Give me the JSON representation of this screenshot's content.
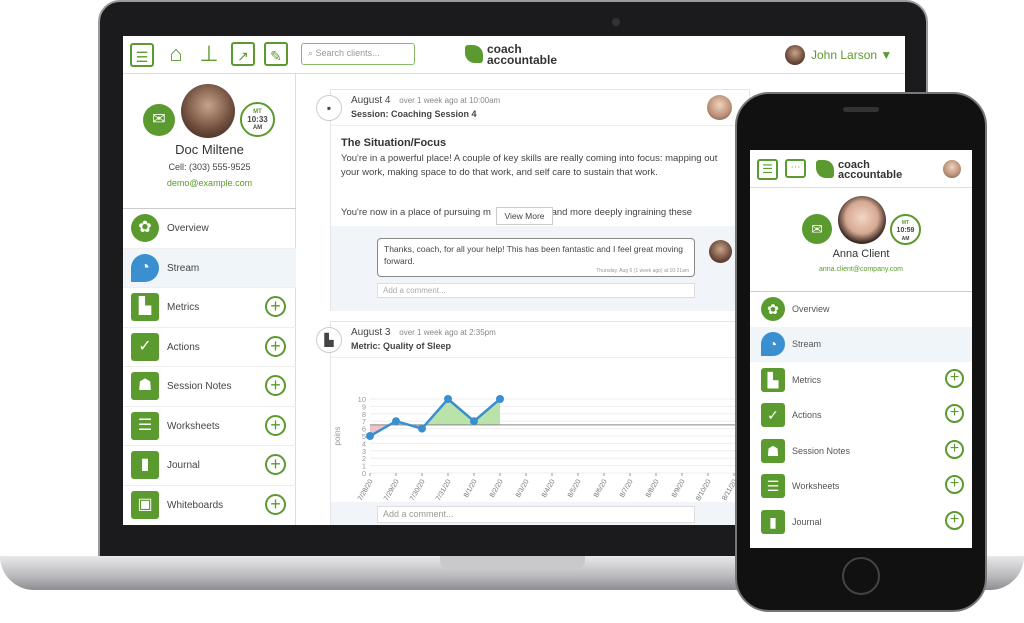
{
  "colors": {
    "brand": "#5b9a2e",
    "series": "#3a8fd0",
    "above": "#b9e3a8",
    "below": "#f2c3c6"
  },
  "laptop": {
    "header": {
      "icons": [
        "menu-icon",
        "home-icon",
        "org-chart-icon",
        "clipboard-chart-icon",
        "worksheet-icon"
      ],
      "search_placeholder": "Search clients...",
      "logo_line1": "coach",
      "logo_line2": "accountable",
      "user_name": "John Larson ▼"
    },
    "profile": {
      "name": "Doc Miltene",
      "cell": "Cell: (303) 555-9525",
      "email": "demo@example.com",
      "clock_tz": "MT",
      "clock_time": "10:33",
      "clock_ampm": "AM"
    },
    "nav": [
      {
        "label": "Overview"
      },
      {
        "label": "Stream"
      },
      {
        "label": "Metrics"
      },
      {
        "label": "Actions"
      },
      {
        "label": "Session Notes"
      },
      {
        "label": "Worksheets"
      },
      {
        "label": "Journal"
      },
      {
        "label": "Whiteboards"
      }
    ],
    "feed": [
      {
        "date": "August 4",
        "ago": "over 1 week ago at 10:00am",
        "title": "Session: Coaching Session 4",
        "heading": "The Situation/Focus",
        "p1": "You're in a powerful place!  A couple of key skills are really coming into focus: mapping out your work, making space to do that work, and self care to sustain that work.",
        "p2": "You're now in a place of pursuing m                    g and more deeply ingraining these",
        "view_more": "View More",
        "comment": "Thanks, coach, for all your help!  This has been fantastic and I feel great moving forward.",
        "comment_time": "Thursday, Aug 6 (1 week ago) at 10:21am",
        "add_comment": "Add a comment..."
      },
      {
        "date": "August 3",
        "ago": "over 1 week ago at 2:35pm",
        "title": "Metric: Quality of Sleep",
        "add_comment": "Add a comment..."
      }
    ]
  },
  "chart_data": {
    "type": "line",
    "ylabel": "poins",
    "ylim": [
      0,
      10
    ],
    "yticks": [
      0,
      1,
      2,
      3,
      4,
      5,
      6,
      7,
      8,
      9,
      10
    ],
    "target": 6.5,
    "categories": [
      "7/28/20",
      "7/29/20",
      "7/30/20",
      "7/31/20",
      "8/1/20",
      "8/2/20",
      "8/3/20",
      "8/4/20",
      "8/5/20",
      "8/6/20",
      "8/7/20",
      "8/8/20",
      "8/9/20",
      "8/10/20",
      "8/11/20"
    ],
    "values": [
      5,
      7,
      6,
      10,
      7,
      10,
      null,
      null,
      null,
      null,
      null,
      null,
      null,
      null,
      null
    ],
    "grid": true
  },
  "phone": {
    "header": {
      "logo_line1": "coach",
      "logo_line2": "accountable"
    },
    "profile": {
      "name": "Anna Client",
      "email": "anna.client@company.com",
      "clock_tz": "MT",
      "clock_time": "10:59",
      "clock_ampm": "AM"
    },
    "nav": [
      {
        "label": "Overview"
      },
      {
        "label": "Stream"
      },
      {
        "label": "Metrics"
      },
      {
        "label": "Actions"
      },
      {
        "label": "Session Notes"
      },
      {
        "label": "Worksheets"
      },
      {
        "label": "Journal"
      }
    ]
  }
}
